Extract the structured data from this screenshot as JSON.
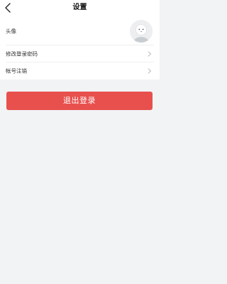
{
  "header": {
    "title": "设置",
    "back_icon": "chevron-left-icon"
  },
  "settings": {
    "avatar_label": "头像",
    "change_password_label": "修改登录密码",
    "cancel_account_label": "帐号注销",
    "chevron_icon": "chevron-right-icon"
  },
  "actions": {
    "logout_label": "退出登录"
  },
  "colors": {
    "logout_button": "#e8504e",
    "page_background": "#f2f3f5",
    "list_background": "#ffffff"
  }
}
